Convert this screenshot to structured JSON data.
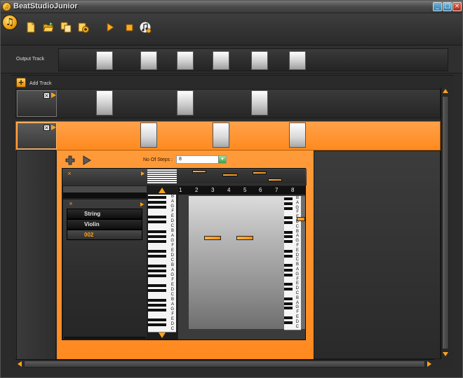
{
  "window": {
    "title": "BeatStudioJunior",
    "minimize_glyph": "_",
    "maximize_glyph": "□",
    "close_glyph": "×"
  },
  "toolbar": {
    "icons": [
      "new-file-icon",
      "open-folder-icon",
      "copy-icon",
      "export-icon",
      "play-icon",
      "stop-icon",
      "music-settings-icon"
    ],
    "logo_glyph": "♫"
  },
  "output_track": {
    "label": "Output Track"
  },
  "tracks": {
    "add_label": "Add Track",
    "add_glyph": "+",
    "close_glyph": "×"
  },
  "editor": {
    "steps_label": "No Of Steps :",
    "steps_value": "8",
    "steps_arrow": "▾",
    "close_glyph": "×",
    "step_numbers": [
      "1",
      "2",
      "3",
      "4",
      "5",
      "6",
      "7",
      "8"
    ],
    "instruments": [
      {
        "label": "String",
        "selected": false
      },
      {
        "label": "Violin",
        "selected": false
      },
      {
        "label": "002",
        "selected": true
      }
    ],
    "keyboard_notes": [
      "B",
      "A",
      "G",
      "F",
      "E",
      "D",
      "C",
      "B",
      "A",
      "G",
      "F",
      "E",
      "D",
      "C",
      "B",
      "A",
      "G",
      "F",
      "E",
      "D",
      "C",
      "B",
      "A",
      "G",
      "F",
      "E",
      "D",
      "C"
    ]
  },
  "colors": {
    "accent": "#ff9a2e",
    "background": "#2b2b2b"
  }
}
